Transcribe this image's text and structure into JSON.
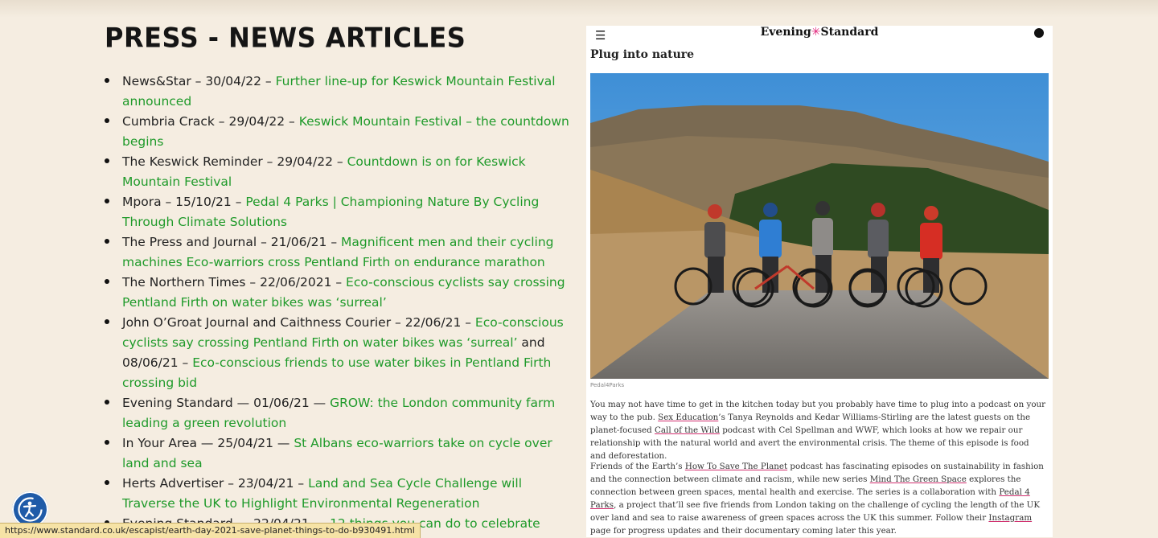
{
  "page": {
    "title": "PRESS - NEWS ARTICLES"
  },
  "articles": [
    {
      "source": "News&Star – 30/04/22 – ",
      "link": "Further line-up for Keswick Mountain Festival announced"
    },
    {
      "source": "Cumbria Crack – 29/04/22 – ",
      "link": "Keswick Mountain Festival – the countdown begins"
    },
    {
      "source": "The Keswick Reminder – 29/04/22 – ",
      "link": "Countdown is on for Keswick Mountain Festival"
    },
    {
      "source": "Mpora – 15/10/21 – ",
      "link": "Pedal 4 Parks | Championing Nature By Cycling Through Climate Solutions"
    },
    {
      "source": "The Press and Journal – 21/06/21 – ",
      "link": "Magnificent men and their cycling machines Eco-warriors cross Pentland Firth on endurance marathon"
    },
    {
      "source": "The Northern Times – 22/06/2021 – ",
      "link": "Eco-conscious cyclists say crossing Pentland Firth on water bikes was ‘surreal’"
    },
    {
      "source": "John O’Groat Journal and Caithness Courier – 22/06/21 – ",
      "link": "Eco-conscious cyclists say crossing Pentland Firth on water bikes was ‘surreal’",
      "middle": " and 08/06/21 – ",
      "link2": "Eco-conscious friends to use water bikes in Pentland Firth crossing bid"
    },
    {
      "source": "Evening Standard — 01/06/21 — ",
      "link": "GROW: the London community farm leading a green revolution"
    },
    {
      "source": "In Your Area — 25/04/21 — ",
      "link": "St Albans eco-warriors take on cycle over land and sea"
    },
    {
      "source": "Herts Advertiser – 23/04/21 – ",
      "link": "Land and Sea Cycle Challenge will Traverse the UK to Highlight Environmental Regeneration"
    },
    {
      "source": "Evening Standard — 22/04/21 — ",
      "link": "12 things you can do to celebrate"
    }
  ],
  "clipping": {
    "menu_icon": "hamburger-icon",
    "logo_left": "Evening",
    "logo_mark": "✳",
    "logo_right": "Standard",
    "account_icon": "account-icon",
    "headline": "Plug into nature",
    "photo_credit": "Pedal4Parks",
    "p1_a": "You may not have time to get in the kitchen today but you probably have time to plug into a podcast on your way to the pub. ",
    "p1_link1": "Sex Education",
    "p1_b": "’s Tanya Reynolds and Kedar Williams-Stirling are the latest guests on the planet-focused ",
    "p1_link2": "Call of the Wild",
    "p1_c": " podcast with Cel Spellman and WWF, which looks at how we repair our relationship with the natural world and avert the environmental crisis. The theme of this episode is food and deforestation.",
    "p2_a": "Friends of the Earth’s ",
    "p2_link1": "How To Save The Planet",
    "p2_b": " podcast has fascinating episodes on sustainability in fashion and the connection between climate and racism, while new series ",
    "p2_link2": "Mind The Green Space",
    "p2_c": " explores the connection between green spaces, mental health and exercise. The series is a collaboration with ",
    "p2_link3": "Pedal 4 Parks",
    "p2_d": ", a project that’ll see five friends from London taking on the challenge of cycling the length of the UK over land and sea to raise awareness of green spaces across the UK this summer. Follow their ",
    "p2_link4": "Instagram",
    "p2_e": " page for progress updates and their documentary coming later this year."
  },
  "status_bar": {
    "url": "https://www.standard.co.uk/escapist/earth-day-2021-save-planet-things-to-do-b930491.html"
  },
  "widgets": {
    "accessibility_icon": "accessibility-icon"
  },
  "colors": {
    "background": "#f5ede1",
    "link_green": "#1f9a2a",
    "accessibility_blue": "#1f5ba8",
    "status_bar": "#f6e3a6"
  }
}
